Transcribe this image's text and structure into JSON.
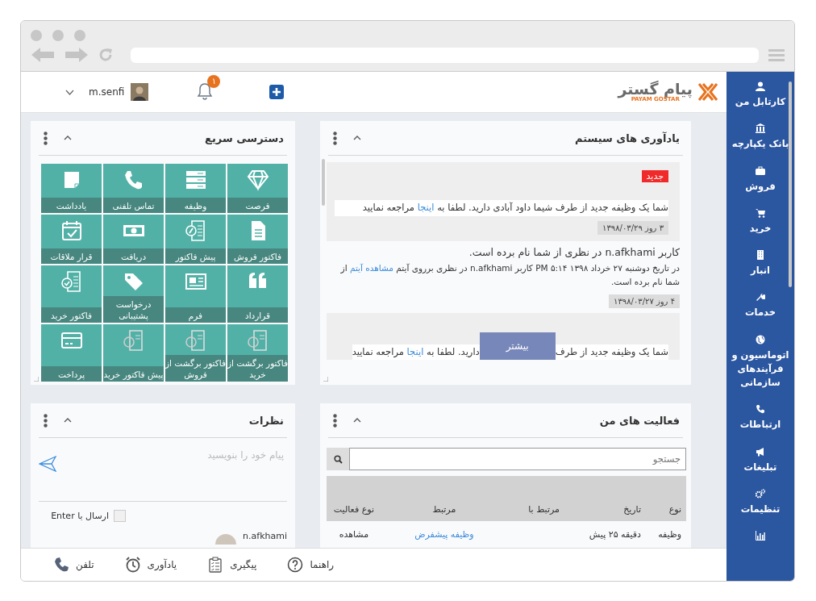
{
  "header": {
    "logo_text": "پیام گستر",
    "logo_subtitle": "PAYAM GOSTAR",
    "notification_count": "۱",
    "user_name": "m.senfi"
  },
  "sidebar": {
    "items": [
      {
        "label": "کارتابل من"
      },
      {
        "label": "بانک یکپارچه"
      },
      {
        "label": "فروش"
      },
      {
        "label": "خرید"
      },
      {
        "label": "انبار"
      },
      {
        "label": "خدمات"
      },
      {
        "label": "اتوماسیون و فرآیندهای سازمانی"
      },
      {
        "label": "ارتباطات"
      },
      {
        "label": "تبلیغات"
      },
      {
        "label": "تنظیمات"
      }
    ]
  },
  "reminders": {
    "title": "یادآوری های سیستم",
    "items": [
      {
        "kind": "task",
        "new": true,
        "badge": "جدید",
        "text": "شما یک وظیفه جدید از طرف شیما داود آبادی دارید. لطفا به",
        "link": "اینجا",
        "tail": "مراجعه نمایید",
        "date": "۳ روز ۱۳۹۸/۰۳/۲۹"
      },
      {
        "kind": "mention",
        "title": "کاربر n.afkhami در نظری از شما نام برده است.",
        "text": "در تاریخ دوشنبه ۲۷ خرداد ۱۳۹۸ ۵:۱۴ PM کاربر n.afkhami در نظری برروی آیتم",
        "link": "مشاهده آیتم",
        "tail": "از شما نام برده است.",
        "date": "۴ روز ۱۳۹۸/۰۳/۲۷"
      },
      {
        "kind": "task_partial",
        "new": false,
        "text": "شما یک وظیفه جدید از طرف",
        "after": "دارید. لطفا به",
        "link": "اینجا",
        "tail": "مراجعه نمایید"
      }
    ],
    "more_button": "بیشتر"
  },
  "quick_access": {
    "title": "دسترسی سریع",
    "tiles": [
      {
        "label": "فرصت"
      },
      {
        "label": "وظیفه"
      },
      {
        "label": "تماس تلفنی"
      },
      {
        "label": "یادداشت"
      },
      {
        "label": "فاکتور فروش"
      },
      {
        "label": "پیش فاکتور"
      },
      {
        "label": "دریافت"
      },
      {
        "label": "قرار ملاقات"
      },
      {
        "label": "قرارداد"
      },
      {
        "label": "فرم"
      },
      {
        "label": "درخواست پشتیبانی"
      },
      {
        "label": "فاکتور خرید"
      },
      {
        "label": "فاکتور برگشت از خرید"
      },
      {
        "label": "فاکتور برگشت از فروش"
      },
      {
        "label": "پیش فاکتور خرید"
      },
      {
        "label": "پرداخت"
      }
    ]
  },
  "activities": {
    "title": "فعالیت های من",
    "search_placeholder": "جستجو",
    "columns": [
      "نوع",
      "تاریخ",
      "مرتبط با",
      "مرتبط",
      "نوع فعالیت"
    ],
    "rows": [
      {
        "cells": [
          "وظیفه",
          "دقیقه ۲۵ پیش",
          null,
          "وظیفه پیشفرض",
          "مشاهده"
        ]
      }
    ]
  },
  "comments": {
    "title": "نظرات",
    "placeholder": "پیام خود را بنویسید",
    "send_on_enter": {
      "label": "ارسال با Enter",
      "checked": false
    },
    "comments": [
      {
        "user": "n.afkhami"
      }
    ]
  },
  "bottom_bar": {
    "items": [
      {
        "label": "راهنما"
      },
      {
        "label": "پیگیری"
      },
      {
        "label": "یادآوری"
      },
      {
        "label": "تلفن"
      }
    ]
  }
}
